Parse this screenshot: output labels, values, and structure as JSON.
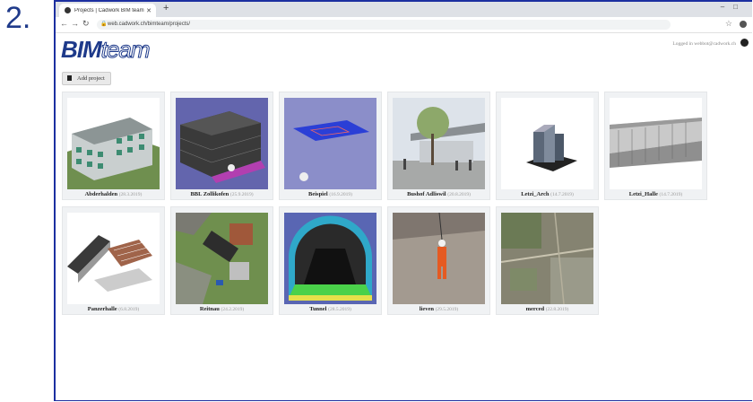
{
  "step": "2.",
  "browser": {
    "tab_title": "Projects | Cadwork BIM team",
    "url": "web.cadwork.ch/bimteam/projects/"
  },
  "header": {
    "logo_bold": "BIM",
    "logo_light": "team",
    "logged_in": "Logged in webbot@cadwork.ch"
  },
  "toolbar": {
    "add_label": "Add project"
  },
  "projects": [
    {
      "name": "Abderhalden",
      "date": "(28.3.2019)"
    },
    {
      "name": "BBL Zollikofen",
      "date": "(25.9.2019)"
    },
    {
      "name": "Beispiel",
      "date": "(16.9.2019)"
    },
    {
      "name": "Bushof Adliswil",
      "date": "(20.8.2019)"
    },
    {
      "name": "Letzi_Arch",
      "date": "(14.7.2019)"
    },
    {
      "name": "Letzi_Halle",
      "date": "(14.7.2019)"
    },
    {
      "name": "Panzerhalle",
      "date": "(6.8.2019)"
    },
    {
      "name": "Reitnau",
      "date": "(24.2.2019)"
    },
    {
      "name": "Tunnel",
      "date": "(28.5.2019)"
    },
    {
      "name": "lieven",
      "date": "(29.5.2019)"
    },
    {
      "name": "merced",
      "date": "(22.8.2019)"
    }
  ]
}
